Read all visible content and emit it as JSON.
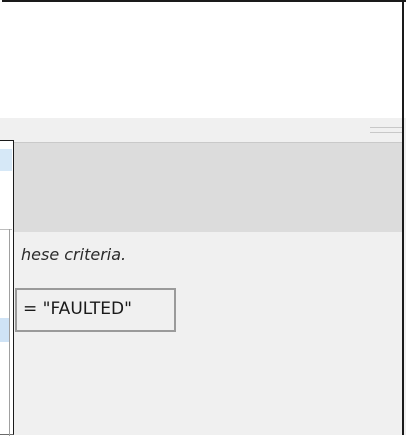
{
  "hint_text": "hese criteria.",
  "filter_expression": "= \"FAULTED\""
}
